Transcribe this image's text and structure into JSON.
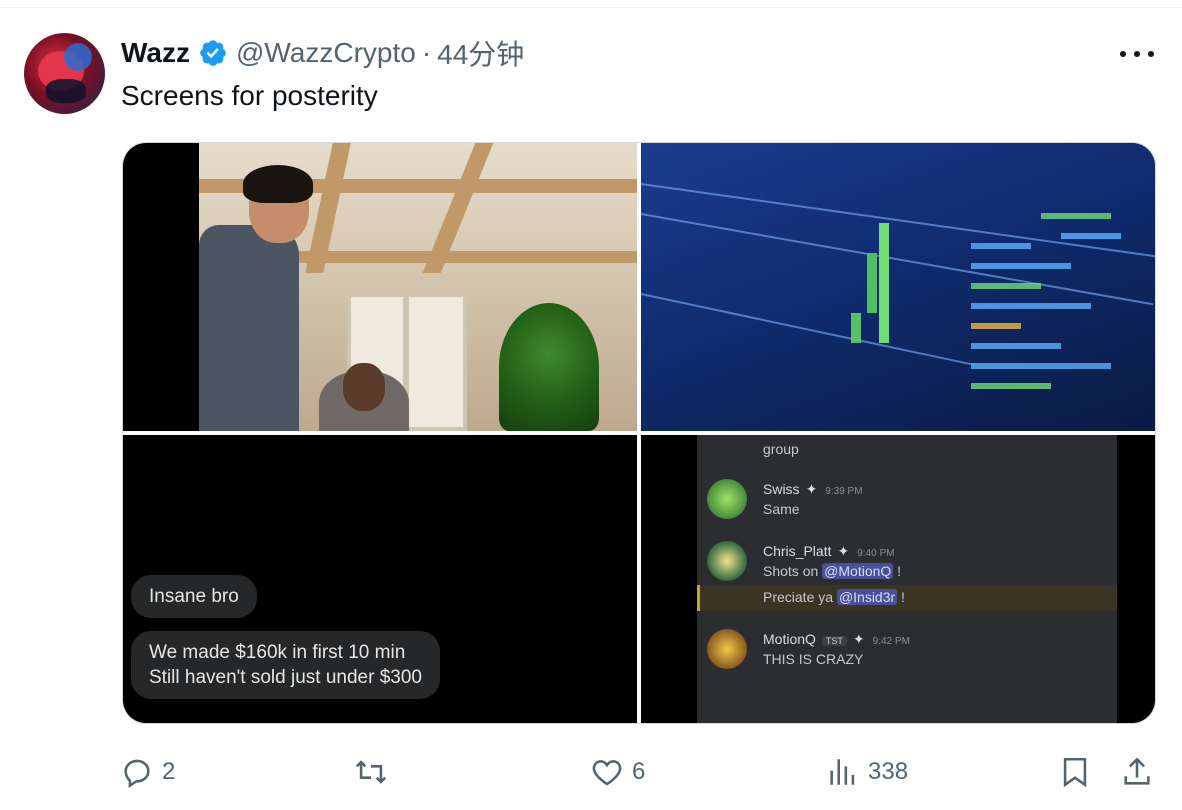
{
  "tweet": {
    "display_name": "Wazz",
    "handle": "@WazzCrypto",
    "separator": "·",
    "time": "44分钟",
    "text": "Screens for posterity"
  },
  "media": {
    "image1_caption": "",
    "messages": [
      "Insane bro",
      "We made $160k in first 10 min",
      "Still haven't sold just under $300"
    ],
    "discord": {
      "top_text": "group",
      "messages": [
        {
          "user": "Swiss",
          "time": "9:39 PM",
          "text": "Same"
        },
        {
          "user": "Chris_Platt",
          "time": "9:40 PM",
          "text_prefix": "Shots on ",
          "mention": "@MotionQ",
          "text_suffix": " !"
        },
        {
          "text_prefix": "Preciate ya ",
          "mention": "@Insid3r",
          "text_suffix": " !"
        },
        {
          "user": "MotionQ",
          "tag": "TST",
          "time": "9:42 PM",
          "text": "THIS IS CRAZY"
        }
      ]
    }
  },
  "actions": {
    "reply_count": "2",
    "retweet_count": "",
    "like_count": "6",
    "view_count": "338"
  },
  "icons": {
    "verified": "verified-badge-icon",
    "more": "more-icon",
    "reply": "reply-icon",
    "retweet": "retweet-icon",
    "like": "like-icon",
    "views": "views-icon",
    "bookmark": "bookmark-icon",
    "share": "share-icon"
  },
  "colors": {
    "verified_blue": "#1d9bf0",
    "secondary_text": "#536471",
    "primary_text": "#0f1419"
  }
}
